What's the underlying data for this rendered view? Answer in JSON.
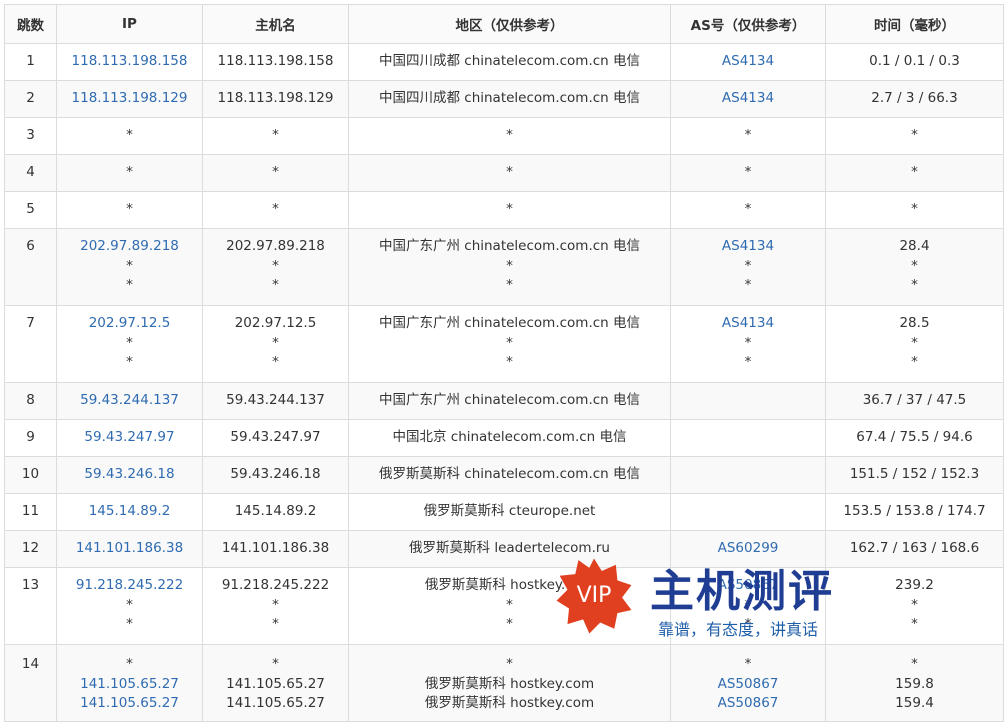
{
  "headers": [
    "跳数",
    "IP",
    "主机名",
    "地区（仅供参考）",
    "AS号（仅供参考）",
    "时间（毫秒）"
  ],
  "rows": [
    {
      "hop": "1",
      "ip": [
        "118.113.198.158"
      ],
      "host": [
        "118.113.198.158"
      ],
      "region": [
        "中国四川成都 chinatelecom.com.cn 电信"
      ],
      "as": [
        "AS4134"
      ],
      "time": [
        "0.1 / 0.1 / 0.3"
      ]
    },
    {
      "hop": "2",
      "ip": [
        "118.113.198.129"
      ],
      "host": [
        "118.113.198.129"
      ],
      "region": [
        "中国四川成都 chinatelecom.com.cn 电信"
      ],
      "as": [
        "AS4134"
      ],
      "time": [
        "2.7 / 3 / 66.3"
      ]
    },
    {
      "hop": "3",
      "ip": [
        "*"
      ],
      "host": [
        "*"
      ],
      "region": [
        "*"
      ],
      "as": [
        "*"
      ],
      "time": [
        "*"
      ]
    },
    {
      "hop": "4",
      "ip": [
        "*"
      ],
      "host": [
        "*"
      ],
      "region": [
        "*"
      ],
      "as": [
        "*"
      ],
      "time": [
        "*"
      ]
    },
    {
      "hop": "5",
      "ip": [
        "*"
      ],
      "host": [
        "*"
      ],
      "region": [
        "*"
      ],
      "as": [
        "*"
      ],
      "time": [
        "*"
      ]
    },
    {
      "hop": "6",
      "ip": [
        "202.97.89.218",
        "*",
        "*"
      ],
      "host": [
        "202.97.89.218",
        "*",
        "*"
      ],
      "region": [
        "中国广东广州 chinatelecom.com.cn 电信",
        "*",
        "*"
      ],
      "as": [
        "AS4134",
        "*",
        "*"
      ],
      "time": [
        "28.4",
        "*",
        "*"
      ]
    },
    {
      "hop": "7",
      "ip": [
        "202.97.12.5",
        "*",
        "*"
      ],
      "host": [
        "202.97.12.5",
        "*",
        "*"
      ],
      "region": [
        "中国广东广州 chinatelecom.com.cn 电信",
        "*",
        "*"
      ],
      "as": [
        "AS4134",
        "*",
        "*"
      ],
      "time": [
        "28.5",
        "*",
        "*"
      ]
    },
    {
      "hop": "8",
      "ip": [
        "59.43.244.137"
      ],
      "host": [
        "59.43.244.137"
      ],
      "region": [
        "中国广东广州 chinatelecom.com.cn 电信"
      ],
      "as": [
        ""
      ],
      "time": [
        "36.7 / 37 / 47.5"
      ]
    },
    {
      "hop": "9",
      "ip": [
        "59.43.247.97"
      ],
      "host": [
        "59.43.247.97"
      ],
      "region": [
        "中国北京 chinatelecom.com.cn 电信"
      ],
      "as": [
        ""
      ],
      "time": [
        "67.4 / 75.5 / 94.6"
      ]
    },
    {
      "hop": "10",
      "ip": [
        "59.43.246.18"
      ],
      "host": [
        "59.43.246.18"
      ],
      "region": [
        "俄罗斯莫斯科 chinatelecom.com.cn 电信"
      ],
      "as": [
        ""
      ],
      "time": [
        "151.5 / 152 / 152.3"
      ]
    },
    {
      "hop": "11",
      "ip": [
        "145.14.89.2"
      ],
      "host": [
        "145.14.89.2"
      ],
      "region": [
        "俄罗斯莫斯科 cteurope.net"
      ],
      "as": [
        ""
      ],
      "time": [
        "153.5 / 153.8 / 174.7"
      ]
    },
    {
      "hop": "12",
      "ip": [
        "141.101.186.38"
      ],
      "host": [
        "141.101.186.38"
      ],
      "region": [
        "俄罗斯莫斯科 leadertelecom.ru"
      ],
      "as": [
        "AS60299"
      ],
      "time": [
        "162.7 / 163 / 168.6"
      ]
    },
    {
      "hop": "13",
      "ip": [
        "91.218.245.222",
        "*",
        "*"
      ],
      "host": [
        "91.218.245.222",
        "*",
        "*"
      ],
      "region": [
        "俄罗斯莫斯科 hostkey.com",
        "*",
        "*"
      ],
      "as": [
        "AS50867",
        "*",
        "*"
      ],
      "time": [
        "239.2",
        "*",
        "*"
      ]
    },
    {
      "hop": "14",
      "ip": [
        "*",
        "141.105.65.27",
        "141.105.65.27"
      ],
      "host": [
        "*",
        "141.105.65.27",
        "141.105.65.27"
      ],
      "region": [
        "*",
        "俄罗斯莫斯科 hostkey.com",
        "俄罗斯莫斯科 hostkey.com"
      ],
      "as": [
        "*",
        "AS50867",
        "AS50867"
      ],
      "time": [
        "*",
        "159.8",
        "159.4"
      ]
    }
  ],
  "watermark": {
    "badge": "VIP",
    "title": "主机测评",
    "subtitle": "靠谱，有态度，讲真话"
  },
  "colors": {
    "link": "#2f6bb1",
    "watermark_title": "#1f3d93",
    "badge": "#e0401f"
  }
}
